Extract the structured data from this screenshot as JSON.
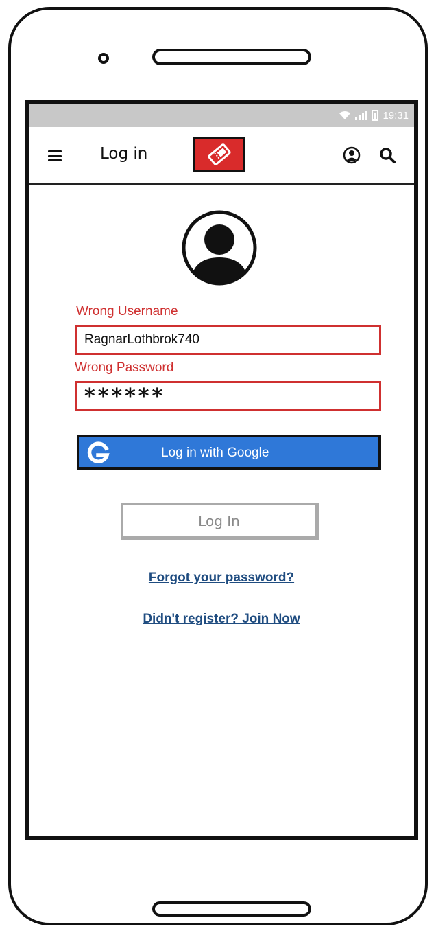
{
  "status_bar": {
    "time": "19:31"
  },
  "app_bar": {
    "title": "Log in",
    "logo_icon": "ticket-icon",
    "logo_color": "#d92b2b",
    "account_icon": "user-circle-icon",
    "search_icon": "search-icon",
    "menu_icon": "hamburger-menu-icon"
  },
  "form": {
    "username_error": "Wrong Username",
    "username_value": "RagnarLothbrok740",
    "password_error": "Wrong Password",
    "password_value": "******",
    "error_color": "#cf3030"
  },
  "buttons": {
    "google_label": "Log in with Google",
    "google_color": "#2f78d8",
    "login_label": "Log In"
  },
  "links": {
    "forgot_password": "Forgot your password?",
    "join_now": "Didn't register? Join Now"
  }
}
